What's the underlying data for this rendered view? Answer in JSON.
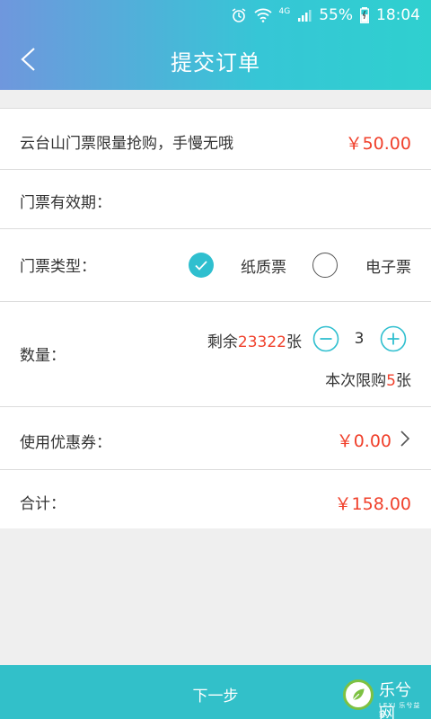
{
  "statusbar": {
    "network": "4G",
    "battery": "55%",
    "time": "18:04"
  },
  "header": {
    "title": "提交订单"
  },
  "product": {
    "name": "云台山门票限量抢购，手慢无哦",
    "price": "￥50.00"
  },
  "validity": {
    "label": "门票有效期："
  },
  "ticket_type": {
    "label": "门票类型：",
    "options": [
      "纸质票",
      "电子票"
    ],
    "selected": "纸质票"
  },
  "quantity": {
    "label": "数量：",
    "remain_prefix": "剩余",
    "remain_count": "23322",
    "remain_suffix": "张",
    "value": "3",
    "limit_prefix": "本次限购",
    "limit_count": "5",
    "limit_suffix": "张"
  },
  "coupon": {
    "label": "使用优惠券：",
    "value": "￥0.00"
  },
  "total": {
    "label": "合计：",
    "value": "￥158.00"
  },
  "footer": {
    "next_label": "下一步"
  },
  "watermark": {
    "name": "乐兮网",
    "sub": "LEXI 乐兮益家"
  },
  "colors": {
    "accent": "#2fbfcf",
    "price": "#f0402b",
    "footer": "#32c0c9"
  }
}
